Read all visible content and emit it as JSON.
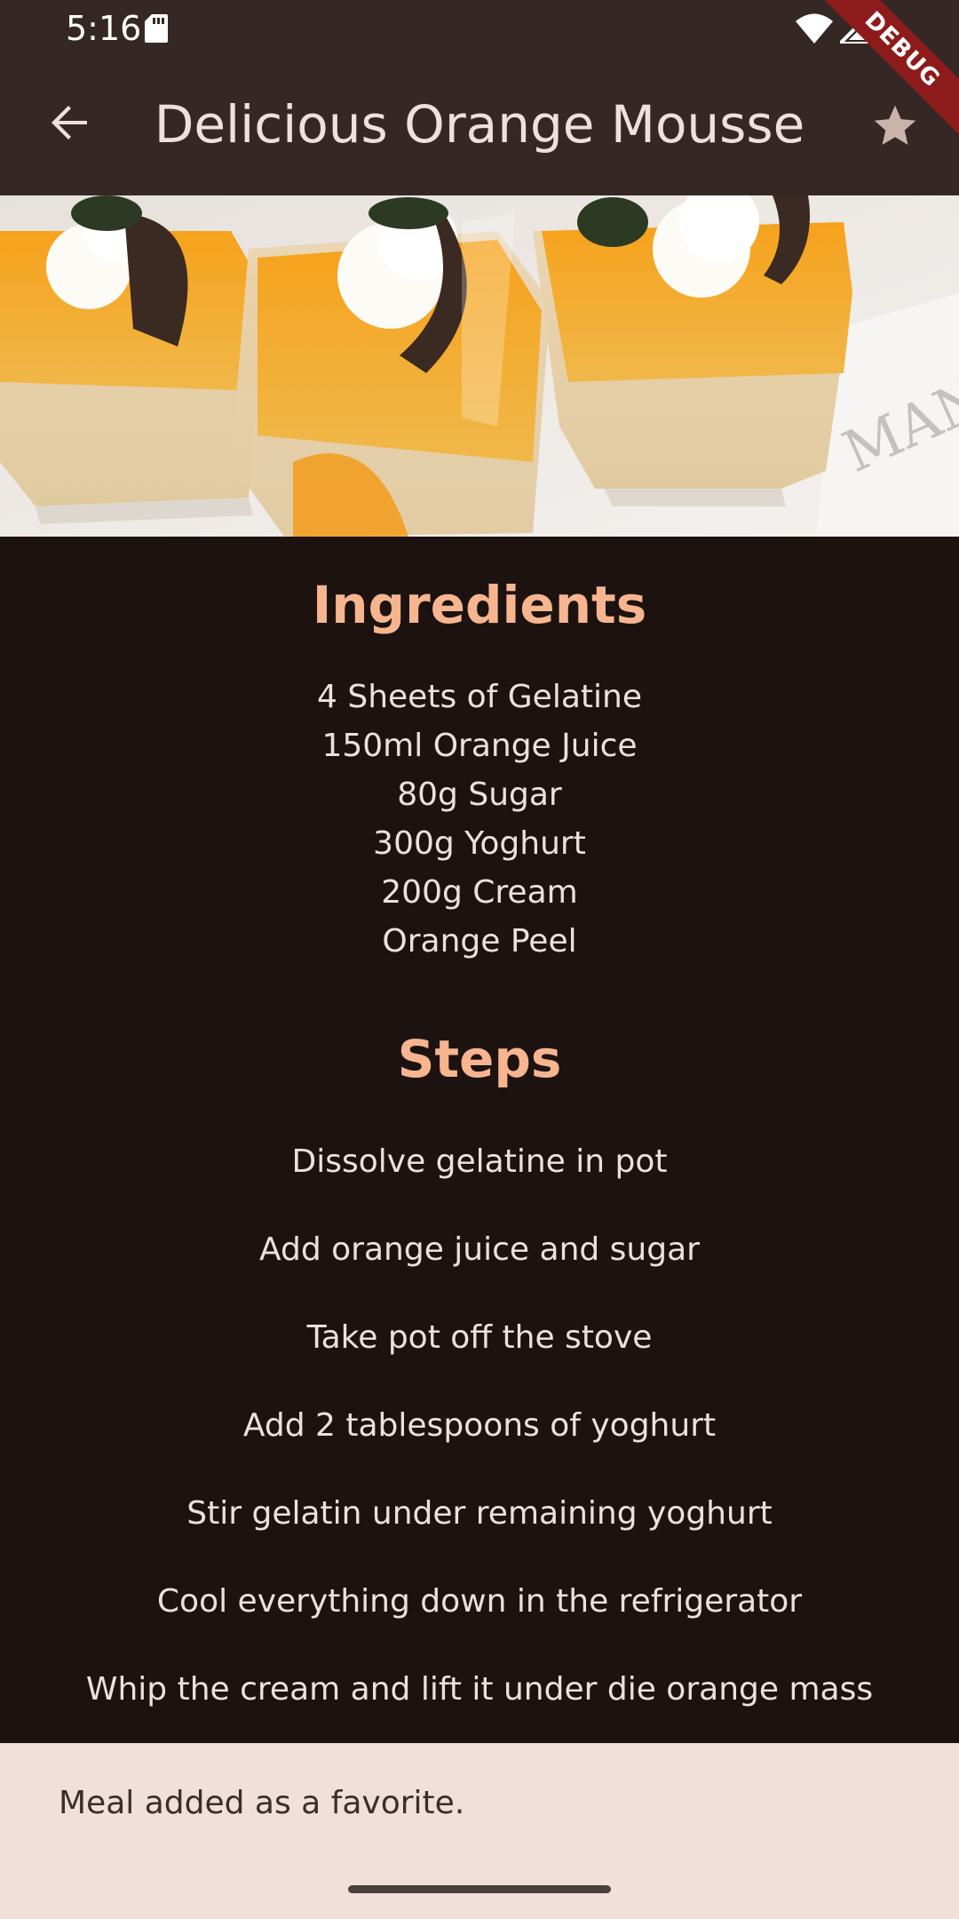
{
  "status_bar": {
    "time": "5:16"
  },
  "app_bar": {
    "title": "Delicious Orange Mousse",
    "back_icon": "arrow-back-icon",
    "favorite_icon": "star-icon"
  },
  "debug_banner": {
    "label": "DEBUG"
  },
  "ingredients": {
    "title": "Ingredients",
    "items": [
      "4 Sheets of Gelatine",
      "150ml Orange Juice",
      "80g Sugar",
      "300g Yoghurt",
      "200g Cream",
      "Orange Peel"
    ]
  },
  "steps": {
    "title": "Steps",
    "items": [
      "Dissolve gelatine in pot",
      "Add orange juice and sugar",
      "Take pot off the stove",
      "Add 2 tablespoons of yoghurt",
      "Stir gelatin under remaining yoghurt",
      "Cool everything down in the refrigerator",
      "Whip the cream and lift it under die orange mass"
    ]
  },
  "snackbar": {
    "message": "Meal added as a favorite."
  },
  "colors": {
    "app_bar": "#352824",
    "background": "#1c1311",
    "accent": "#f7b58f",
    "text": "#eee0da",
    "snackbar": "#f1dfd9"
  }
}
